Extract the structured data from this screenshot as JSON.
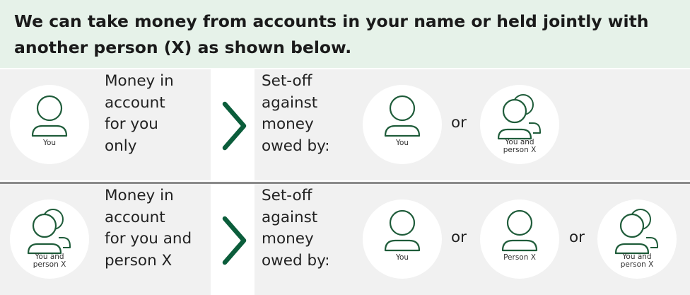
{
  "header": {
    "text": "We can take money from accounts in your name or held jointly with another person (X) as shown below."
  },
  "rows": [
    {
      "source_icon": "single-person-icon",
      "source_caption": "You",
      "money_text": "Money in\naccount\nfor you\nonly",
      "setoff_text": "Set-off\nagainst\nmoney\nowed by:",
      "or_words": [
        "or"
      ],
      "targets": [
        {
          "icon": "single-person-icon",
          "caption": "You"
        },
        {
          "icon": "two-people-icon",
          "caption": "You and\nperson X"
        }
      ]
    },
    {
      "source_icon": "two-people-icon",
      "source_caption": "You and\nperson X",
      "money_text": "Money in\naccount\nfor you and\nperson X",
      "setoff_text": "Set-off\nagainst\nmoney\nowed by:",
      "or_words": [
        "or",
        "or"
      ],
      "targets": [
        {
          "icon": "single-person-icon",
          "caption": "You"
        },
        {
          "icon": "single-person-icon",
          "caption": "Person X"
        },
        {
          "icon": "two-people-icon",
          "caption": "You and\nperson X"
        }
      ]
    }
  ],
  "colors": {
    "header_bg": "#e6f2e9",
    "row_bg": "#f1f1f1",
    "accent_green": "#0b5d3b",
    "icon_green": "#1f5c3a"
  }
}
